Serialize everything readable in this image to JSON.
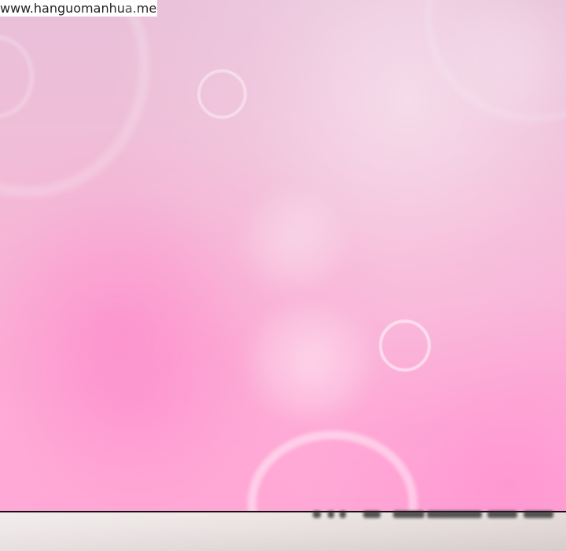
{
  "watermark": {
    "text": "www.hanguomanhua.me"
  },
  "colors": {
    "background_top": "#e9c0d9",
    "background_bottom": "#ffaad6",
    "ring": "#ffffff",
    "floor": "#ede6e5",
    "divider": "#111111"
  }
}
